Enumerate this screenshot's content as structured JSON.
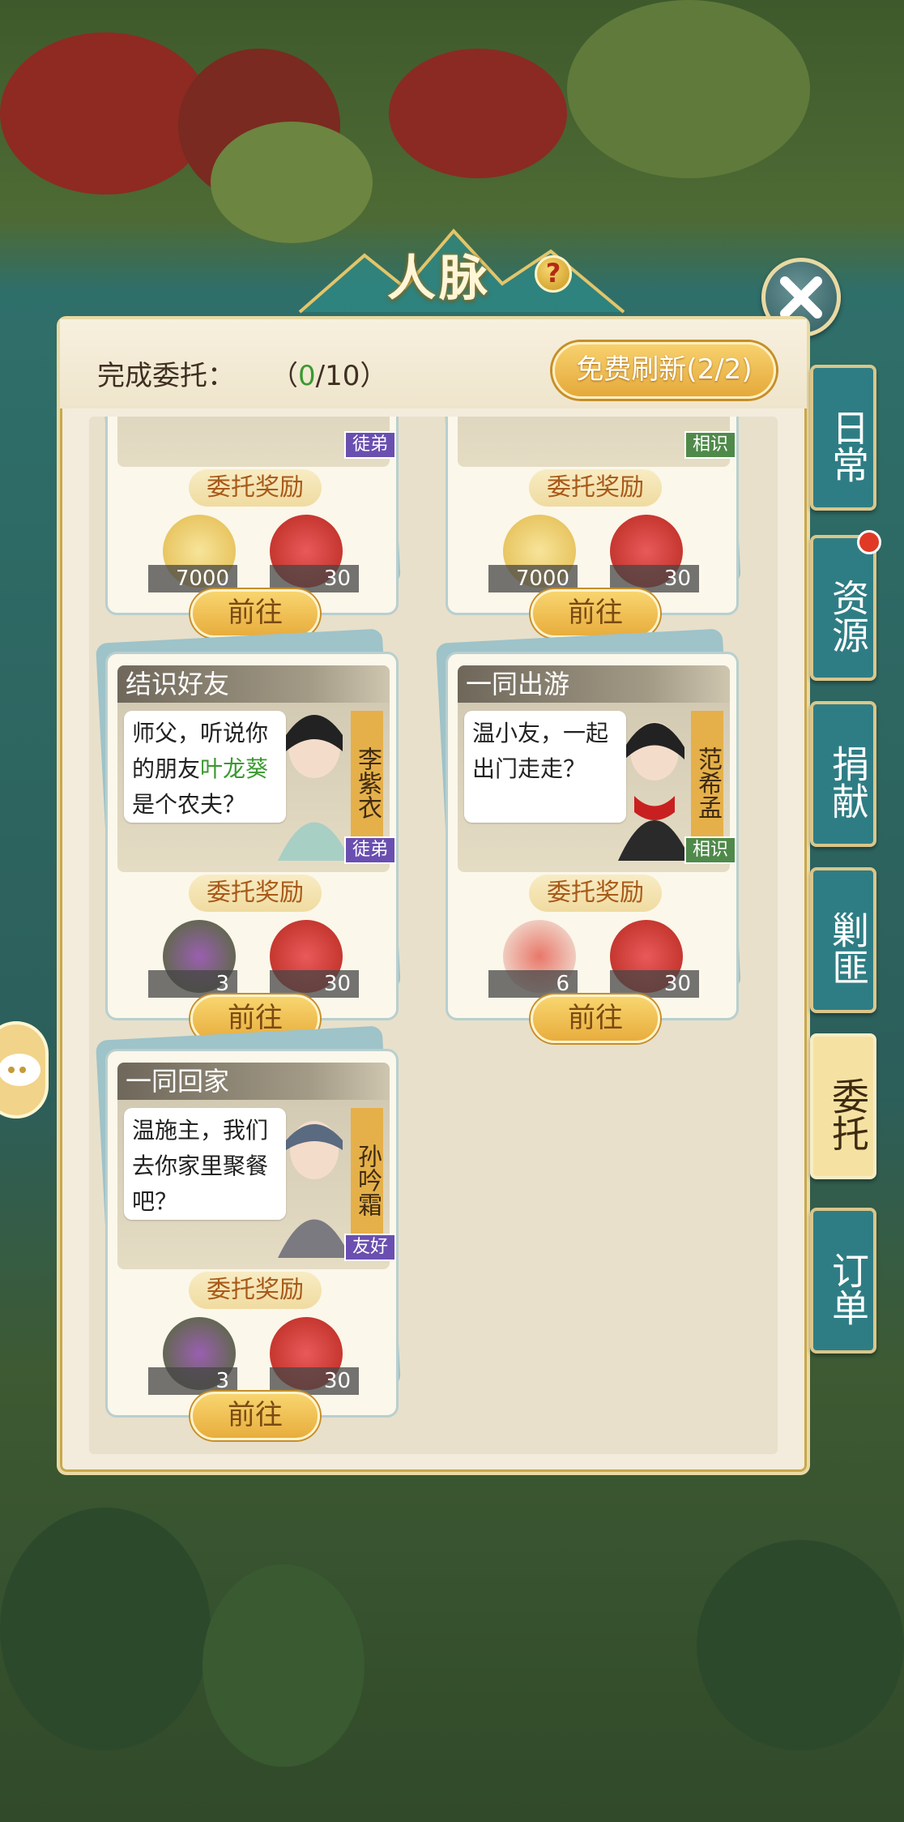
{
  "header": {
    "title": "人脉",
    "help_icon": "?"
  },
  "progress": {
    "label": "完成委托：",
    "open": "（",
    "done": "0",
    "sep": "/10）"
  },
  "refresh_button": "免费刷新(2/2)",
  "side_tabs": [
    {
      "label": "日常",
      "active": false
    },
    {
      "label": "资源",
      "active": false,
      "badge": true
    },
    {
      "label": "捐献",
      "active": false
    },
    {
      "label": "剿匪",
      "active": false
    },
    {
      "label": "委托",
      "active": true
    },
    {
      "label": "订单",
      "active": false
    }
  ],
  "reward_label": "委托奖励",
  "go_button": "前往",
  "top_cards": [
    {
      "tag": "徒弟",
      "rewards": [
        {
          "icon": "coins-icon",
          "qty": "7000"
        },
        {
          "icon": "heart-icon",
          "qty": "30"
        }
      ]
    },
    {
      "tag": "相识",
      "rewards": [
        {
          "icon": "coins-icon",
          "qty": "7000"
        },
        {
          "icon": "heart-icon",
          "qty": "30"
        }
      ]
    }
  ],
  "cards": [
    {
      "title": "结识好友",
      "text_pre": "师父，听说你的朋友",
      "text_hl": "叶龙葵",
      "text_post": "是个农夫？",
      "npc": "李紫衣",
      "tag": "徒弟",
      "rewards": [
        {
          "icon": "flower-icon",
          "qty": "3"
        },
        {
          "icon": "heart-icon",
          "qty": "30"
        }
      ]
    },
    {
      "title": "一同出游",
      "text_pre": "温小友，一起出门走走？",
      "text_hl": "",
      "text_post": "",
      "npc": "范希孟",
      "tag": "相识",
      "rewards": [
        {
          "icon": "noodle-bowl-icon",
          "qty": "6"
        },
        {
          "icon": "heart-icon",
          "qty": "30"
        }
      ]
    },
    {
      "title": "一同回家",
      "text_pre": "温施主，我们去你家里聚餐吧？",
      "text_hl": "",
      "text_post": "",
      "npc": "孙吟霜",
      "tag": "友好",
      "rewards": [
        {
          "icon": "flower-icon",
          "qty": "3"
        },
        {
          "icon": "heart-icon",
          "qty": "30"
        }
      ]
    }
  ]
}
